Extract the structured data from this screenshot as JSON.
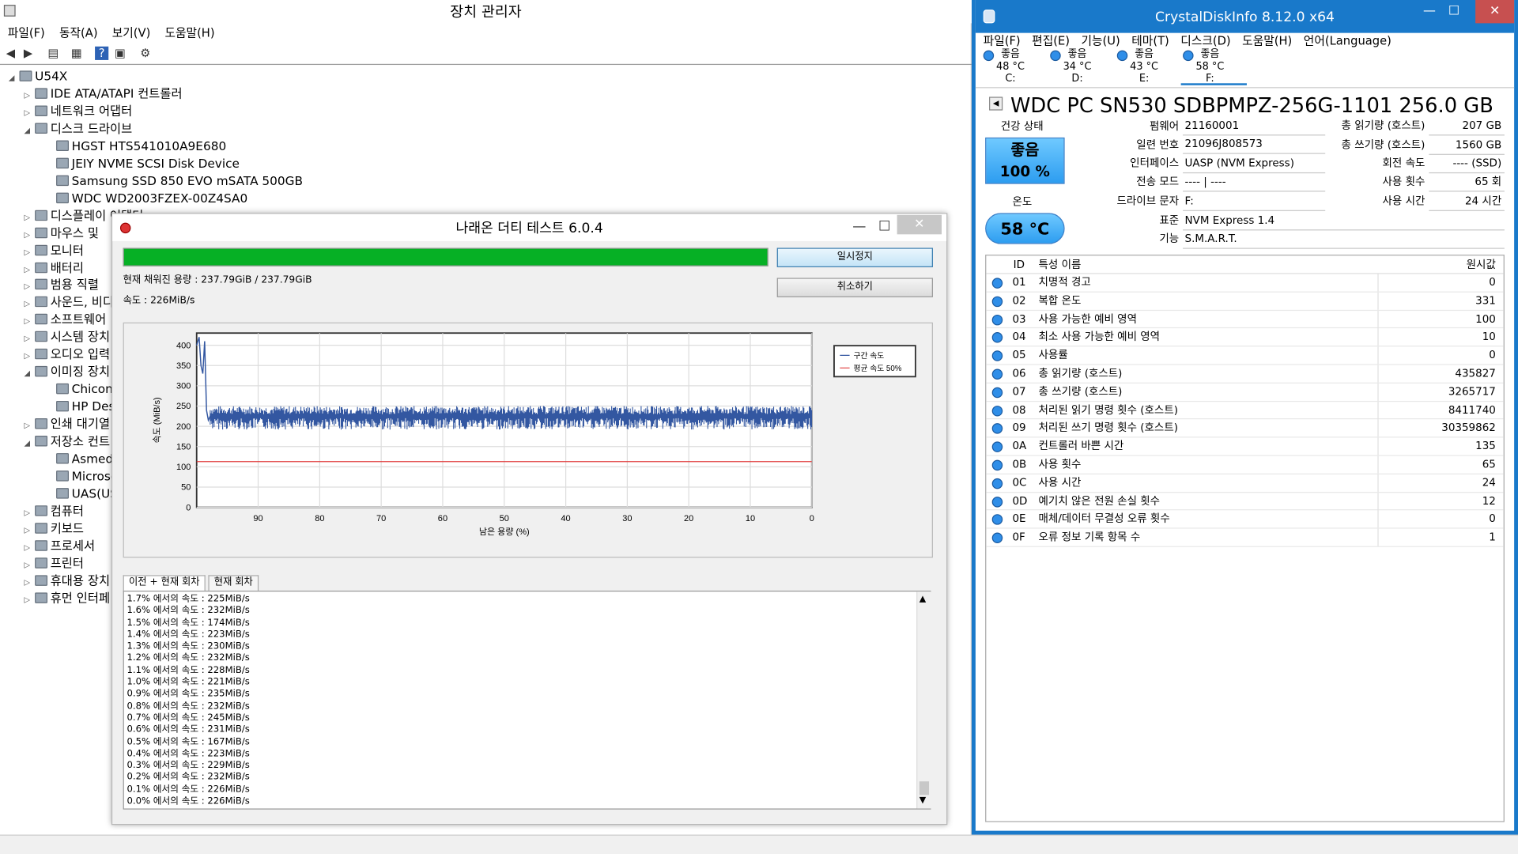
{
  "device_manager": {
    "title": "장치 관리자",
    "menu": [
      "파일(F)",
      "동작(A)",
      "보기(V)",
      "도움말(H)"
    ],
    "root": "U54X",
    "tree": [
      {
        "label": "IDE ATA/ATAPI 컨트롤러",
        "level": 1,
        "exp": "▷"
      },
      {
        "label": "네트워크 어댑터",
        "level": 1,
        "exp": "▷"
      },
      {
        "label": "디스크 드라이브",
        "level": 1,
        "exp": "◢"
      },
      {
        "label": "HGST HTS541010A9E680",
        "level": 2,
        "exp": ""
      },
      {
        "label": "JEIY NVME SCSI Disk Device",
        "level": 2,
        "exp": ""
      },
      {
        "label": "Samsung SSD 850 EVO mSATA 500GB",
        "level": 2,
        "exp": ""
      },
      {
        "label": "WDC WD2003FZEX-00Z4SA0",
        "level": 2,
        "exp": ""
      },
      {
        "label": "디스플레이 어댑터",
        "level": 1,
        "exp": "▷"
      },
      {
        "label": "마우스 및 ",
        "level": 1,
        "exp": "▷"
      },
      {
        "label": "모니터",
        "level": 1,
        "exp": "▷"
      },
      {
        "label": "배터리",
        "level": 1,
        "exp": "▷"
      },
      {
        "label": "범용 직렬 ",
        "level": 1,
        "exp": "▷"
      },
      {
        "label": "사운드, 비디",
        "level": 1,
        "exp": "▷"
      },
      {
        "label": "소프트웨어",
        "level": 1,
        "exp": "▷"
      },
      {
        "label": "시스템 장치",
        "level": 1,
        "exp": "▷"
      },
      {
        "label": "오디오 입력",
        "level": 1,
        "exp": "▷"
      },
      {
        "label": "이미징 장치",
        "level": 1,
        "exp": "◢"
      },
      {
        "label": "Chicony",
        "level": 2,
        "exp": ""
      },
      {
        "label": "HP Desk",
        "level": 2,
        "exp": ""
      },
      {
        "label": "인쇄 대기열",
        "level": 1,
        "exp": "▷"
      },
      {
        "label": "저장소 컨트",
        "level": 1,
        "exp": "◢"
      },
      {
        "label": "Asmedia",
        "level": 2,
        "exp": ""
      },
      {
        "label": "Microsof",
        "level": 2,
        "exp": ""
      },
      {
        "label": "UAS(USI",
        "level": 2,
        "exp": ""
      },
      {
        "label": "컴퓨터",
        "level": 1,
        "exp": "▷"
      },
      {
        "label": "키보드",
        "level": 1,
        "exp": "▷"
      },
      {
        "label": "프로세서",
        "level": 1,
        "exp": "▷"
      },
      {
        "label": "프린터",
        "level": 1,
        "exp": "▷"
      },
      {
        "label": "휴대용 장치",
        "level": 1,
        "exp": "▷"
      },
      {
        "label": "휴먼 인터페",
        "level": 1,
        "exp": "▷"
      }
    ]
  },
  "naraeon": {
    "title": "나래온 더티 테스트 6.0.4",
    "pause": "일시정지",
    "cancel": "취소하기",
    "filled": "현재 채워진 용량 : 237.79GiB / 237.79GiB",
    "speed": "속도 : 226MiB/s",
    "tabs": [
      "이전 + 현재 회차",
      "현재 회차"
    ],
    "log": [
      "1.7% 에서의 속도 : 225MiB/s",
      "1.6% 에서의 속도 : 232MiB/s",
      "1.5% 에서의 속도 : 174MiB/s",
      "1.4% 에서의 속도 : 223MiB/s",
      "1.3% 에서의 속도 : 230MiB/s",
      "1.2% 에서의 속도 : 232MiB/s",
      "1.1% 에서의 속도 : 228MiB/s",
      "1.0% 에서의 속도 : 221MiB/s",
      "0.9% 에서의 속도 : 235MiB/s",
      "0.8% 에서의 속도 : 232MiB/s",
      "0.7% 에서의 속도 : 245MiB/s",
      "0.6% 에서의 속도 : 231MiB/s",
      "0.5% 에서의 속도 : 167MiB/s",
      "0.4% 에서의 속도 : 223MiB/s",
      "0.3% 에서의 속도 : 229MiB/s",
      "0.2% 에서의 속도 : 232MiB/s",
      "0.1% 에서의 속도 : 226MiB/s",
      "0.0% 에서의 속도 : 226MiB/s"
    ]
  },
  "chart_data": {
    "type": "line",
    "xlabel": "남은 용량 (%)",
    "ylabel": "속도 (MiB/s)",
    "xlim": [
      100,
      0
    ],
    "ylim": [
      0,
      430
    ],
    "xticks": [
      90,
      80,
      70,
      60,
      50,
      40,
      30,
      20,
      10,
      0
    ],
    "yticks": [
      0,
      50,
      100,
      150,
      200,
      250,
      300,
      350,
      400
    ],
    "series": [
      {
        "name": "구간 속도",
        "color": "#3357a1",
        "x": [
          100,
          99.6,
          99.3,
          99.0,
          98.7,
          98.4,
          98.1,
          97.8,
          95,
          90,
          85,
          80,
          75,
          70,
          65,
          60,
          55,
          50,
          45,
          40,
          35,
          30,
          25,
          20,
          15,
          10,
          5,
          0
        ],
        "values": [
          400,
          420,
          350,
          330,
          410,
          240,
          215,
          225,
          222,
          226,
          224,
          228,
          223,
          227,
          225,
          226,
          224,
          227,
          225,
          226,
          224,
          228,
          225,
          226,
          224,
          227,
          225,
          226
        ]
      },
      {
        "name": "평균 속도 50%",
        "color": "#e03b3b",
        "x": [
          100,
          0
        ],
        "values": [
          113,
          113
        ]
      }
    ]
  },
  "crystal": {
    "title": "CrystalDiskInfo 8.12.0 x64",
    "menu": [
      "파일(F)",
      "편집(E)",
      "기능(U)",
      "테마(T)",
      "디스크(D)",
      "도움말(H)",
      "언어(Language)"
    ],
    "drives": [
      {
        "status": "좋음",
        "temp": "48 °C",
        "letter": "C:"
      },
      {
        "status": "좋음",
        "temp": "34 °C",
        "letter": "D:"
      },
      {
        "status": "좋음",
        "temp": "43 °C",
        "letter": "E:"
      },
      {
        "status": "좋음",
        "temp": "58 °C",
        "letter": "F:"
      }
    ],
    "model": "WDC PC SN530 SDBPMPZ-256G-1101 256.0 GB",
    "health_label": "건강 상태",
    "health_status": "좋음",
    "health_pct": "100 %",
    "temp_label": "온도",
    "temp": "58 °C",
    "fields": {
      "fw_k": "펌웨어",
      "fw_v": "21160001",
      "sn_k": "일련 번호",
      "sn_v": "21096J808573",
      "if_k": "인터페이스",
      "if_v": "UASP (NVM Express)",
      "tm_k": "전송 모드",
      "tm_v": "---- | ----",
      "dl_k": "드라이브 문자",
      "dl_v": "F:",
      "std_k": "표준",
      "std_v": "NVM Express 1.4",
      "feat_k": "기능",
      "feat_v": "S.M.A.R.T.",
      "rd_k": "총 읽기량 (호스트)",
      "rd_v": "207 GB",
      "wr_k": "총 쓰기량 (호스트)",
      "wr_v": "1560 GB",
      "rot_k": "회전 속도",
      "rot_v": "---- (SSD)",
      "pc_k": "사용 횟수",
      "pc_v": "65 회",
      "ph_k": "사용 시간",
      "ph_v": "24 시간"
    },
    "smart_headers": {
      "id": "ID",
      "name": "특성 이름",
      "raw": "원시값"
    },
    "smart": [
      {
        "id": "01",
        "name": "치명적 경고",
        "raw": "0"
      },
      {
        "id": "02",
        "name": "복합 온도",
        "raw": "331"
      },
      {
        "id": "03",
        "name": "사용 가능한 예비 영역",
        "raw": "100"
      },
      {
        "id": "04",
        "name": "최소 사용 가능한 예비 영역",
        "raw": "10"
      },
      {
        "id": "05",
        "name": "사용률",
        "raw": "0"
      },
      {
        "id": "06",
        "name": "총 읽기량 (호스트)",
        "raw": "435827"
      },
      {
        "id": "07",
        "name": "총 쓰기량 (호스트)",
        "raw": "3265717"
      },
      {
        "id": "08",
        "name": "처리된 읽기 명령 횟수 (호스트)",
        "raw": "8411740"
      },
      {
        "id": "09",
        "name": "처리된 쓰기 명령 횟수 (호스트)",
        "raw": "30359862"
      },
      {
        "id": "0A",
        "name": "컨트롤러 바쁜 시간",
        "raw": "135"
      },
      {
        "id": "0B",
        "name": "사용 횟수",
        "raw": "65"
      },
      {
        "id": "0C",
        "name": "사용 시간",
        "raw": "24"
      },
      {
        "id": "0D",
        "name": "예기치 않은 전원 손실 횟수",
        "raw": "12"
      },
      {
        "id": "0E",
        "name": "매체/데이터 무결성 오류 횟수",
        "raw": "0"
      },
      {
        "id": "0F",
        "name": "오류 정보 기록 항목 수",
        "raw": "1"
      }
    ]
  }
}
